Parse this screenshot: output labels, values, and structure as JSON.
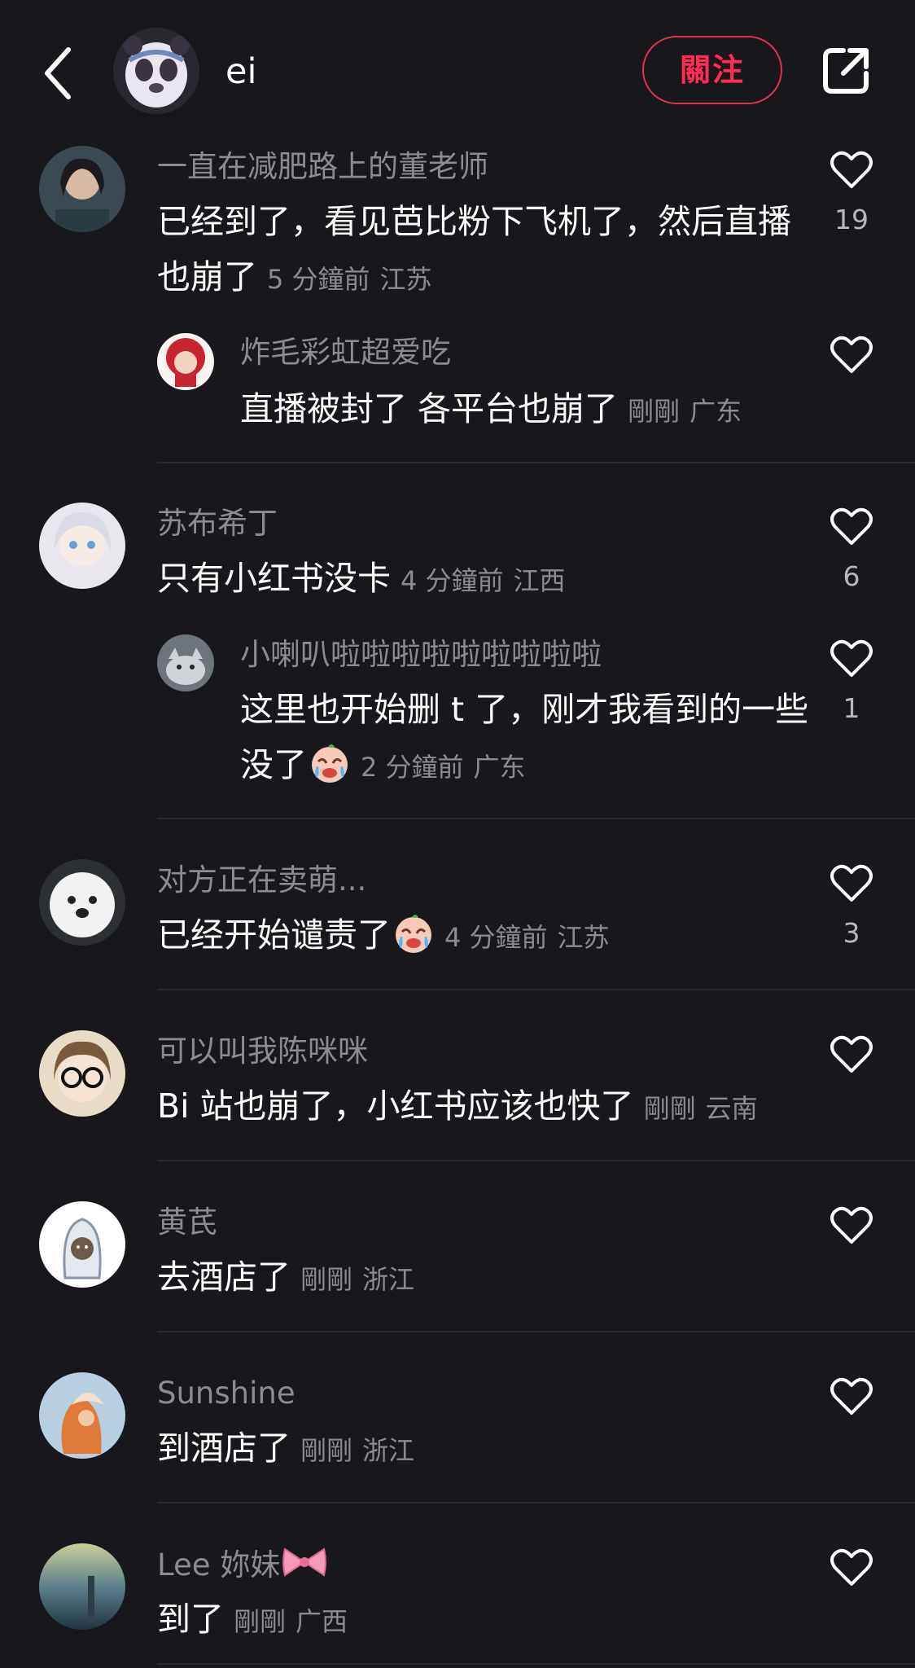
{
  "header": {
    "name": "ei",
    "follow_label": "關注"
  },
  "comments": [
    {
      "user": "一直在减肥路上的董老师",
      "text": "已经到了，看见芭比粉下飞机了，然后直播也崩了",
      "time": "5 分鐘前",
      "location": "江苏",
      "likes": "19",
      "replies": [
        {
          "user": "炸毛彩虹超爱吃",
          "text": "直播被封了 各平台也崩了",
          "time": "剛剛",
          "location": "广东",
          "likes": ""
        }
      ]
    },
    {
      "user": "苏布希丁",
      "text": "只有小红书没卡",
      "time": "4 分鐘前",
      "location": "江西",
      "likes": "6",
      "replies": [
        {
          "user": "小喇叭啦啦啦啦啦啦啦啦啦",
          "text": "这里也开始删 t 了，刚才我看到的一些没了",
          "time": "2 分鐘前",
          "location": "广东",
          "likes": "1"
        }
      ]
    },
    {
      "user": "对方正在卖萌...",
      "text": "已经开始谴责了",
      "time": "4 分鐘前",
      "location": "江苏",
      "likes": "3"
    },
    {
      "user": "可以叫我陈咪咪",
      "text": "Bi 站也崩了，小红书应该也快了",
      "time": "剛剛",
      "location": "云南",
      "likes": ""
    },
    {
      "user": "黄芪",
      "text": "去酒店了",
      "time": "剛剛",
      "location": "浙江",
      "likes": ""
    },
    {
      "user": "Sunshine",
      "text": "到酒店了",
      "time": "剛剛",
      "location": "浙江",
      "likes": ""
    },
    {
      "user": "Lee 妳妹",
      "text": "到了",
      "time": "剛剛",
      "location": "广西",
      "likes": ""
    }
  ],
  "icons": {
    "back": "chevron-left-icon",
    "share": "share-icon",
    "like": "heart-outline-icon",
    "emoji": "crying-laughing-emoji",
    "bow": "pink-bow-emoji"
  },
  "colors": {
    "background": "#18171c",
    "accent": "#ff2d55",
    "muted_text": "#8c8b91"
  }
}
